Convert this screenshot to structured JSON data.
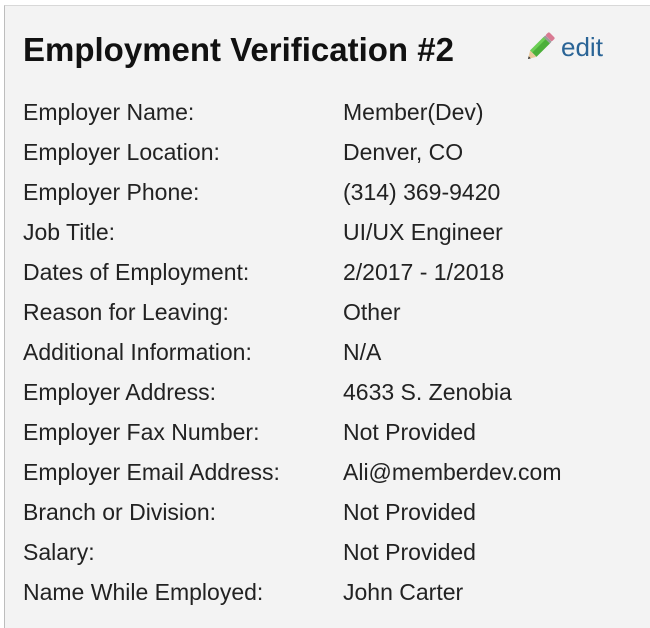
{
  "card": {
    "title": "Employment Verification #2",
    "edit_label": "edit",
    "edit_icon": "pencil-icon"
  },
  "fields": [
    {
      "label": "Employer Name:",
      "value": "Member(Dev)"
    },
    {
      "label": "Employer Location:",
      "value": "Denver, CO"
    },
    {
      "label": "Employer Phone:",
      "value": "(314) 369-9420"
    },
    {
      "label": "Job Title:",
      "value": "UI/UX Engineer"
    },
    {
      "label": "Dates of Employment:",
      "value": "2/2017 - 1/2018"
    },
    {
      "label": "Reason for Leaving:",
      "value": "Other"
    },
    {
      "label": "Additional Information:",
      "value": "N/A"
    },
    {
      "label": "Employer Address:",
      "value": "4633 S. Zenobia"
    },
    {
      "label": "Employer Fax Number:",
      "value": "Not Provided"
    },
    {
      "label": "Employer Email Address:",
      "value": "Ali@memberdev.com"
    },
    {
      "label": "Branch or Division:",
      "value": "Not Provided"
    },
    {
      "label": "Salary:",
      "value": "Not Provided"
    },
    {
      "label": "Name While Employed:",
      "value": "John Carter"
    }
  ],
  "colors": {
    "link": "#2a6496",
    "card_background": "#f3f3f3"
  }
}
